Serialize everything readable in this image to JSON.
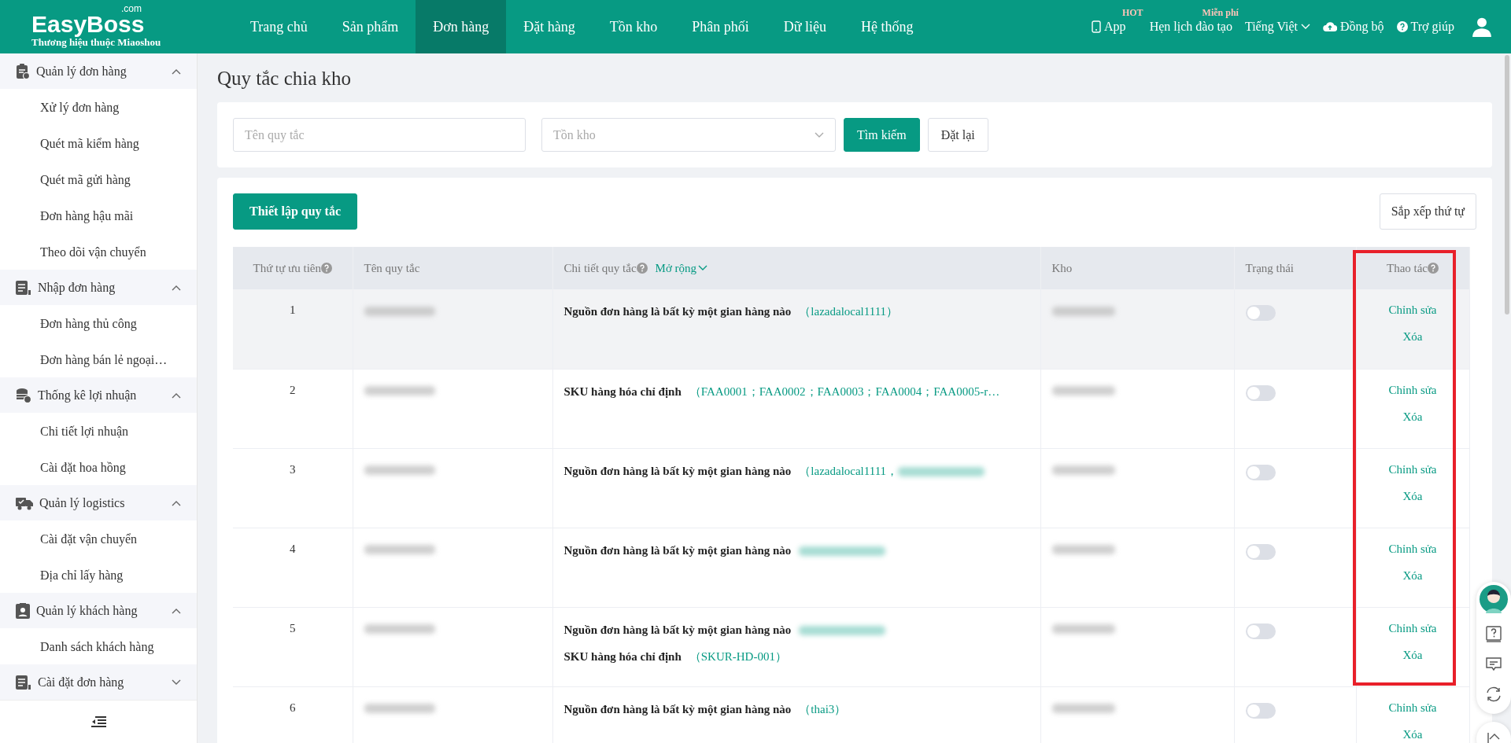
{
  "header": {
    "logo": "EasyBoss",
    "logo_suffix": ".com",
    "tagline": "Thương hiệu thuộc Miaoshou",
    "nav": [
      {
        "label": "Trang chủ",
        "selected": false
      },
      {
        "label": "Sản phẩm",
        "selected": false
      },
      {
        "label": "Đơn hàng",
        "selected": true
      },
      {
        "label": "Đặt hàng",
        "selected": false
      },
      {
        "label": "Tồn kho",
        "selected": false
      },
      {
        "label": "Phân phối",
        "selected": false
      },
      {
        "label": "Dữ liệu",
        "selected": false
      },
      {
        "label": "Hệ thống",
        "selected": false
      }
    ],
    "tools": [
      {
        "kind": "app",
        "label": "App",
        "badge": "HOT"
      },
      {
        "kind": "training",
        "label": "Hẹn lịch đào tạo",
        "badge": "Miễn phí"
      },
      {
        "kind": "language",
        "label": "Tiếng Việt"
      },
      {
        "kind": "sync",
        "label": "Đồng bộ"
      },
      {
        "kind": "help",
        "label": "Trợ giúp"
      },
      {
        "kind": "user"
      }
    ]
  },
  "sidebar": {
    "groups": [
      {
        "label": "Quản lý đơn hàng",
        "expanded": true,
        "items": [
          "Xử lý đơn hàng",
          "Quét mã kiểm hàng",
          "Quét mã gửi hàng",
          "Đơn hàng hậu mãi",
          "Theo dõi vận chuyển"
        ]
      },
      {
        "label": "Nhập đơn hàng",
        "expanded": true,
        "items": [
          "Đơn hàng thủ công",
          "Đơn hàng bán lẻ ngoại…"
        ]
      },
      {
        "label": "Thống kê lợi nhuận",
        "expanded": true,
        "items": [
          "Chi tiết lợi nhuận",
          "Cài đặt hoa hồng"
        ]
      },
      {
        "label": "Quản lý logistics",
        "expanded": true,
        "items": [
          "Cài đặt vận chuyển",
          "Địa chỉ lấy hàng"
        ]
      },
      {
        "label": "Quản lý khách hàng",
        "expanded": true,
        "items": [
          "Danh sách khách hàng"
        ]
      },
      {
        "label": "Cài đặt đơn hàng",
        "expanded": false
      }
    ]
  },
  "page": {
    "title": "Quy tắc chia kho",
    "filters": {
      "name_placeholder": "Tên quy tắc",
      "warehouse_placeholder": "Tồn kho",
      "search_button": "Tìm kiếm",
      "reset_button": "Đặt lại"
    },
    "create_button": "Thiết lập quy tắc",
    "sort_button": "Sắp xếp thứ tự",
    "table": {
      "columns": [
        {
          "label": "Thứ tự ưu tiên",
          "help": true
        },
        {
          "label": "Tên quy tắc"
        },
        {
          "label": "Chi tiết quy tắc",
          "help": true,
          "expand": "Mở rộng"
        },
        {
          "label": "Kho"
        },
        {
          "label": "Trạng thái"
        },
        {
          "label": "Thao tác",
          "help": true
        }
      ],
      "rows": [
        {
          "priority": "1",
          "highlighted": true,
          "details": [
            {
              "label": "Nguồn đơn hàng là bất kỳ một gian hàng nào",
              "parts": [
                {
                  "kind": "text",
                  "text": "（lazadalocal1111）"
                }
              ]
            }
          ],
          "on": false,
          "actions": [
            "Chỉnh sửa",
            "Xóa"
          ]
        },
        {
          "priority": "2",
          "highlighted": false,
          "details": [
            {
              "label": "SKU hàng hóa chỉ định",
              "parts": [
                {
                  "kind": "text",
                  "text": "（FAA0001；FAA0002；FAA0003；FAA0004；FAA0005-r…"
                }
              ]
            }
          ],
          "on": false,
          "actions": [
            "Chỉnh sửa",
            "Xóa"
          ]
        },
        {
          "priority": "3",
          "highlighted": false,
          "details": [
            {
              "label": "Nguồn đơn hàng là bất kỳ một gian hàng nào",
              "parts": [
                {
                  "kind": "text",
                  "text": "（lazadalocal1111，"
                },
                {
                  "kind": "blurred"
                }
              ]
            }
          ],
          "on": false,
          "actions": [
            "Chỉnh sửa",
            "Xóa"
          ]
        },
        {
          "priority": "4",
          "highlighted": false,
          "details": [
            {
              "label": "Nguồn đơn hàng là bất kỳ một gian hàng nào",
              "parts": [
                {
                  "kind": "blurred"
                }
              ]
            }
          ],
          "on": false,
          "actions": [
            "Chỉnh sửa",
            "Xóa"
          ]
        },
        {
          "priority": "5",
          "highlighted": false,
          "details": [
            {
              "label": "Nguồn đơn hàng là bất kỳ một gian hàng nào",
              "parts": [
                {
                  "kind": "blurred"
                }
              ]
            },
            {
              "label": "SKU hàng hóa chỉ định",
              "parts": [
                {
                  "kind": "text",
                  "text": "（SKUR-HD-001）"
                }
              ]
            }
          ],
          "on": false,
          "actions": [
            "Chỉnh sửa",
            "Xóa"
          ]
        },
        {
          "priority": "6",
          "highlighted": false,
          "details": [
            {
              "label": "Nguồn đơn hàng là bất kỳ một gian hàng nào",
              "parts": [
                {
                  "kind": "text",
                  "text": "（thai3）"
                }
              ]
            }
          ],
          "on": false,
          "actions": [
            "Chỉnh sửa",
            "Xóa"
          ]
        }
      ]
    }
  }
}
